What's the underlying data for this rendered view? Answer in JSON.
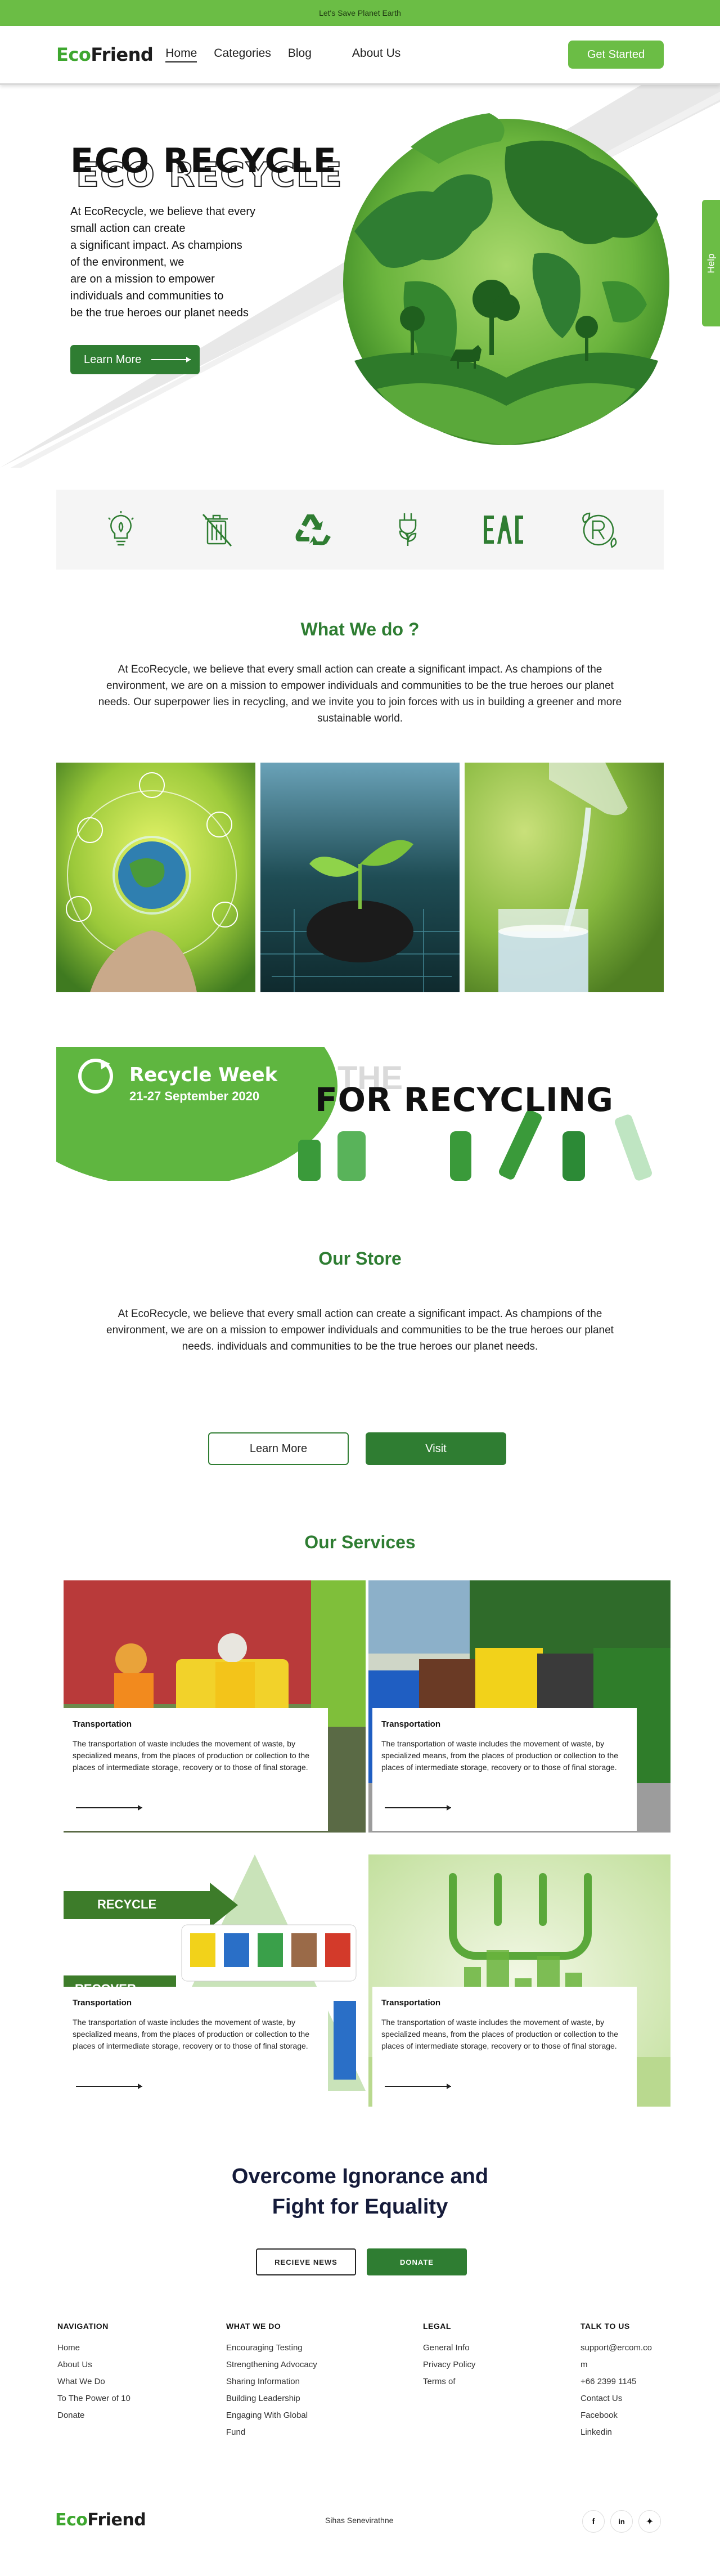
{
  "topbar": {
    "text": "Let's Save Planet Earth"
  },
  "nav": {
    "logo_eco": "Eco",
    "logo_friend": "Friend",
    "links": [
      "Home",
      "Categories",
      "Blog",
      "About Us"
    ],
    "cta": "Get Started"
  },
  "hero": {
    "title": "ECO RECYCLE",
    "lines": [
      "At EcoRecycle, we believe that every",
      " small action can create",
      " a significant impact. As champions",
      " of the environment, we",
      "are on a mission to empower",
      "individuals and communities to",
      " be the true heroes our planet needs"
    ],
    "button": "Learn More",
    "help": "Help"
  },
  "icons": [
    "lightbulb-icon",
    "no-trash-bin-icon",
    "recycle-icon",
    "eco-plug-icon",
    "eac-mark-icon",
    "registered-eco-icon"
  ],
  "what_we_do": {
    "title": "What We do ?",
    "text": "At EcoRecycle, we believe that every small action can create a significant impact. As champions of the environment, we are on a mission to empower individuals and communities to be the true heroes our planet needs. Our superpower lies in recycling, and we invite you to join forces with us in building a greener and more sustainable world."
  },
  "banner": {
    "badge_title": "Recycle Week",
    "badge_date": "21-27 September 2020",
    "heading": "FOR RECYCLING"
  },
  "store": {
    "title": "Our Store",
    "text": "At EcoRecycle, we believe that every small action can create a significant impact. As champions of the environment, we are on a mission to empower individuals and communities to be the true heroes our planet needs.  individuals and communities to be the true heroes our planet needs.",
    "learn_more": "Learn More",
    "visit": "Visit"
  },
  "services": {
    "title": "Our Services",
    "items": [
      {
        "title": "Transportation",
        "desc": "The transportation of waste includes the movement of waste, by specialized means, from the places of production or collection to the places of intermediate storage, recovery or to those of final storage."
      },
      {
        "title": "Transportation",
        "desc": "The transportation of waste includes the movement of waste, by specialized means, from the places of production or collection to the places of intermediate storage, recovery or to those of final storage."
      },
      {
        "title": "Transportation",
        "desc": "The transportation of waste includes the movement of waste, by specialized means, from the places of production or collection to the places of intermediate storage, recovery or to those of final storage."
      },
      {
        "title": "Transportation",
        "desc": "The transportation of waste includes the movement of waste, by specialized means, from the places of production or collection to the places of intermediate storage, recovery or to those of final storage."
      }
    ],
    "image3_labels": {
      "recycle": "RECYCLE",
      "recover": "RECOVER"
    }
  },
  "cta": {
    "line1": "Overcome Ignorance and",
    "line2": "Fight for Equality",
    "receive": "RECIEVE NEWS",
    "donate": "DONATE"
  },
  "footer": {
    "cols": [
      {
        "heading": "NAVIGATION",
        "items": [
          "Home",
          "About Us",
          "What We Do",
          "To The Power of 10",
          "Donate"
        ]
      },
      {
        "heading": "WHAT WE DO",
        "items": [
          "Encouraging Testing",
          "Strengthening Advocacy",
          "Sharing Information",
          "Building Leadership",
          "Engaging With Global",
          "Fund"
        ]
      },
      {
        "heading": "LEGAL",
        "items": [
          "General Info",
          "Privacy Policy",
          "Terms of"
        ]
      },
      {
        "heading": "TALK TO US",
        "items": [
          "support@ercom.co",
          "m",
          "+66 2399 1145",
          "Contact Us",
          "Facebook",
          "Linkedin"
        ]
      }
    ],
    "logo_eco": "Eco",
    "logo_friend": "Friend",
    "credit": "Sihas Senevirathne",
    "social": [
      "f",
      "in",
      "✦"
    ]
  },
  "colors": {
    "brand_green": "#6bbd45",
    "dark_green": "#2f7d32",
    "title_green": "#2e7d32",
    "navy": "#151b3a"
  }
}
